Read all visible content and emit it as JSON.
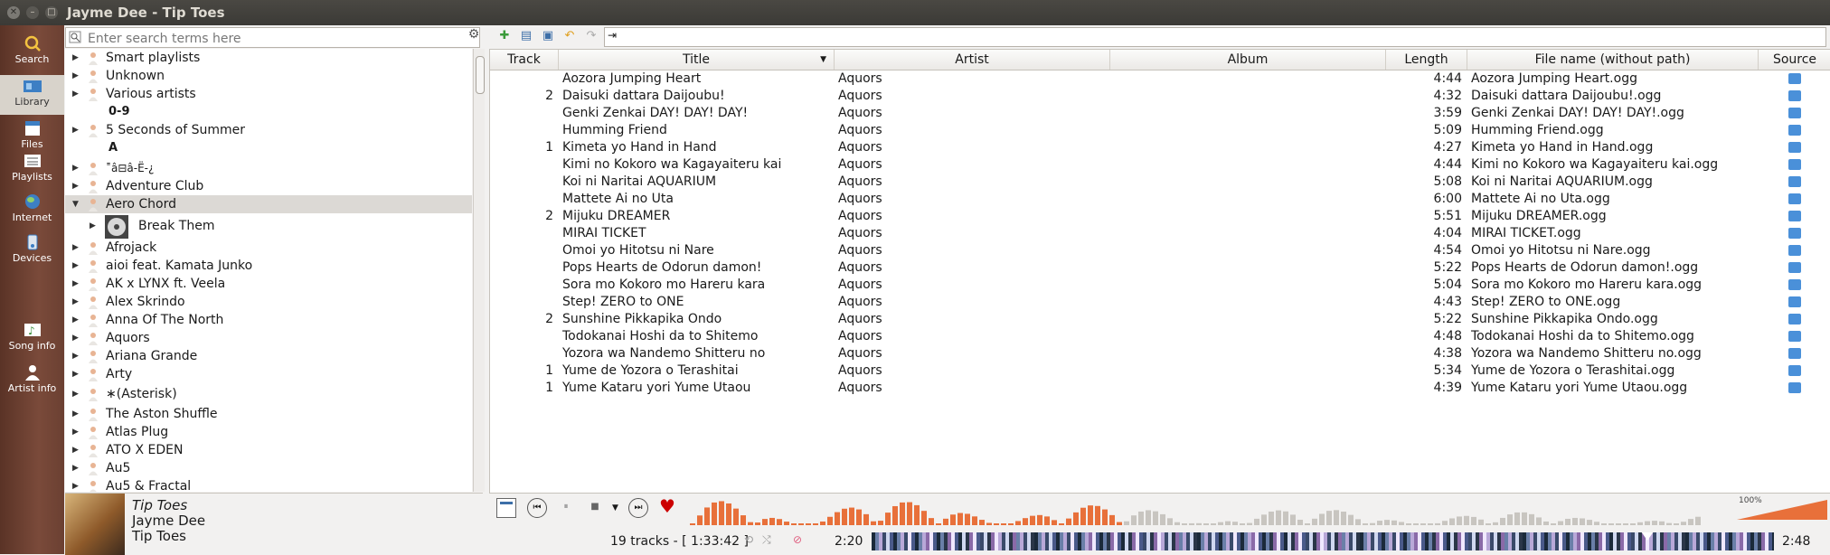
{
  "window": {
    "title": "Jayme Dee - Tip Toes"
  },
  "sidebar": {
    "tabs": [
      {
        "label": "Search",
        "icon": "search-icon"
      },
      {
        "label": "Library",
        "icon": "library-icon",
        "active": true
      },
      {
        "label": "Files",
        "icon": "files-icon"
      },
      {
        "label": "Playlists",
        "icon": "playlists-icon"
      },
      {
        "label": "Internet",
        "icon": "internet-icon"
      },
      {
        "label": "Devices",
        "icon": "devices-icon"
      },
      {
        "label": "Song info",
        "icon": "song-info-icon"
      },
      {
        "label": "Artist info",
        "icon": "artist-info-icon"
      }
    ]
  },
  "library": {
    "search_placeholder": "Enter search terms here",
    "headers": {
      "h09": "0-9",
      "hA": "A"
    },
    "items": [
      "Smart playlists",
      "Unknown",
      "Various artists",
      "5 Seconds of Summer",
      "˭â⊟â-Ë-¿",
      "Adventure Club",
      "Aero Chord",
      "Break Them",
      "Afrojack",
      "aioi feat. Kamata Junko",
      "AK x LYNX ft. Veela",
      "Alex Skrindo",
      "Anna Of The North",
      "Aquors",
      "Ariana Grande",
      "Arty",
      "∗(Asterisk)",
      "The Aston Shuffle",
      "Atlas Plug",
      "ATO X EDEN",
      "Au5",
      "Au5 & Fractal"
    ]
  },
  "now_playing": {
    "title": "Tip Toes",
    "artist": "Jayme Dee",
    "album": "Tip Toes"
  },
  "playlist": {
    "columns": [
      "Track",
      "Title",
      "Artist",
      "Album",
      "Length",
      "File name (without path)",
      "Source"
    ],
    "rows": [
      {
        "track": "",
        "title": "Aozora Jumping Heart",
        "artist": "Aquors",
        "album": "",
        "length": "4:44",
        "file": "Aozora Jumping Heart.ogg"
      },
      {
        "track": "2",
        "title": "Daisuki dattara Daijoubu!",
        "artist": "Aquors",
        "album": "",
        "length": "4:32",
        "file": "Daisuki dattara Daijoubu!.ogg"
      },
      {
        "track": "",
        "title": "Genki Zenkai DAY! DAY! DAY!",
        "artist": "Aquors",
        "album": "",
        "length": "3:59",
        "file": "Genki Zenkai DAY! DAY! DAY!.ogg"
      },
      {
        "track": "",
        "title": "Humming Friend",
        "artist": "Aquors",
        "album": "",
        "length": "5:09",
        "file": "Humming Friend.ogg"
      },
      {
        "track": "1",
        "title": "Kimeta yo Hand in Hand",
        "artist": "Aquors",
        "album": "",
        "length": "4:27",
        "file": "Kimeta yo Hand in Hand.ogg"
      },
      {
        "track": "",
        "title": "Kimi no Kokoro wa Kagayaiteru kai",
        "artist": "Aquors",
        "album": "",
        "length": "4:44",
        "file": "Kimi no Kokoro wa Kagayaiteru kai.ogg"
      },
      {
        "track": "",
        "title": "Koi ni Naritai AQUARIUM",
        "artist": "Aquors",
        "album": "",
        "length": "5:08",
        "file": "Koi ni Naritai AQUARIUM.ogg"
      },
      {
        "track": "",
        "title": "Mattete Ai no Uta",
        "artist": "Aquors",
        "album": "",
        "length": "6:00",
        "file": "Mattete Ai no Uta.ogg"
      },
      {
        "track": "2",
        "title": "Mijuku DREAMER",
        "artist": "Aquors",
        "album": "",
        "length": "5:51",
        "file": "Mijuku DREAMER.ogg"
      },
      {
        "track": "",
        "title": "MIRAI TICKET",
        "artist": "Aquors",
        "album": "",
        "length": "4:04",
        "file": "MIRAI TICKET.ogg"
      },
      {
        "track": "",
        "title": "Omoi yo Hitotsu ni Nare",
        "artist": "Aquors",
        "album": "",
        "length": "4:54",
        "file": "Omoi yo Hitotsu ni Nare.ogg"
      },
      {
        "track": "",
        "title": "Pops Hearts de Odorun damon!",
        "artist": "Aquors",
        "album": "",
        "length": "5:22",
        "file": "Pops Hearts de Odorun damon!.ogg"
      },
      {
        "track": "",
        "title": "Sora mo Kokoro mo Hareru kara",
        "artist": "Aquors",
        "album": "",
        "length": "5:04",
        "file": "Sora mo Kokoro mo Hareru kara.ogg"
      },
      {
        "track": "",
        "title": "Step! ZERO to ONE",
        "artist": "Aquors",
        "album": "",
        "length": "4:43",
        "file": "Step! ZERO to ONE.ogg"
      },
      {
        "track": "2",
        "title": "Sunshine Pikkapika Ondo",
        "artist": "Aquors",
        "album": "",
        "length": "5:22",
        "file": "Sunshine Pikkapika Ondo.ogg"
      },
      {
        "track": "",
        "title": "Todokanai Hoshi da to Shitemo",
        "artist": "Aquors",
        "album": "",
        "length": "4:48",
        "file": "Todokanai Hoshi da to Shitemo.ogg"
      },
      {
        "track": "",
        "title": "Yozora wa Nandemo Shitteru no",
        "artist": "Aquors",
        "album": "",
        "length": "4:38",
        "file": "Yozora wa Nandemo Shitteru no.ogg"
      },
      {
        "track": "1",
        "title": "Yume de Yozora o Terashitai",
        "artist": "Aquors",
        "album": "",
        "length": "5:34",
        "file": "Yume de Yozora o Terashitai.ogg"
      },
      {
        "track": "1",
        "title": "Yume Kataru yori Yume Utaou",
        "artist": "Aquors",
        "album": "",
        "length": "4:39",
        "file": "Yume Kataru yori Yume Utaou.ogg"
      }
    ]
  },
  "player": {
    "status": "19 tracks - [ 1:33:42 ]",
    "time_elapsed": "2:20",
    "time_remaining": "2:48",
    "volume": "100%",
    "volume_level": 1.0,
    "progress": 0.86,
    "love_color": "#cc0000",
    "analyzer_color": "#e8703a"
  },
  "colors": {
    "sidebar": "#6b4032",
    "seek_bar": "#222222"
  }
}
